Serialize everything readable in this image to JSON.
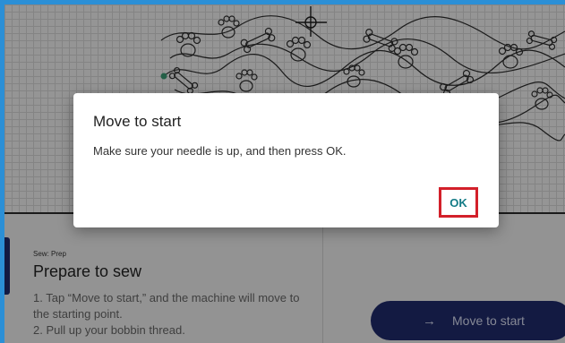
{
  "dialog": {
    "title": "Move to start",
    "message": "Make sure your needle is up, and then press OK.",
    "ok_label": "OK",
    "highlight_color": "#d3202a"
  },
  "panel": {
    "caption": "Sew: Prep",
    "title": "Prepare to sew",
    "steps": [
      "1. Tap “Move to start,” and the machine will move to the starting point.",
      "2. Pull up your bobbin thread."
    ],
    "move_button": {
      "label": "Move to start",
      "icon": "arrow-right-icon"
    }
  },
  "canvas": {
    "pattern": "paw-and-bone quilting design",
    "crosshair_icon": "needle-crosshair-icon",
    "start_marker_color": "#3a9a73"
  },
  "colors": {
    "accent": "#1f2a6b",
    "ok_text": "#137b86",
    "screen_border": "#2b8fd6"
  }
}
